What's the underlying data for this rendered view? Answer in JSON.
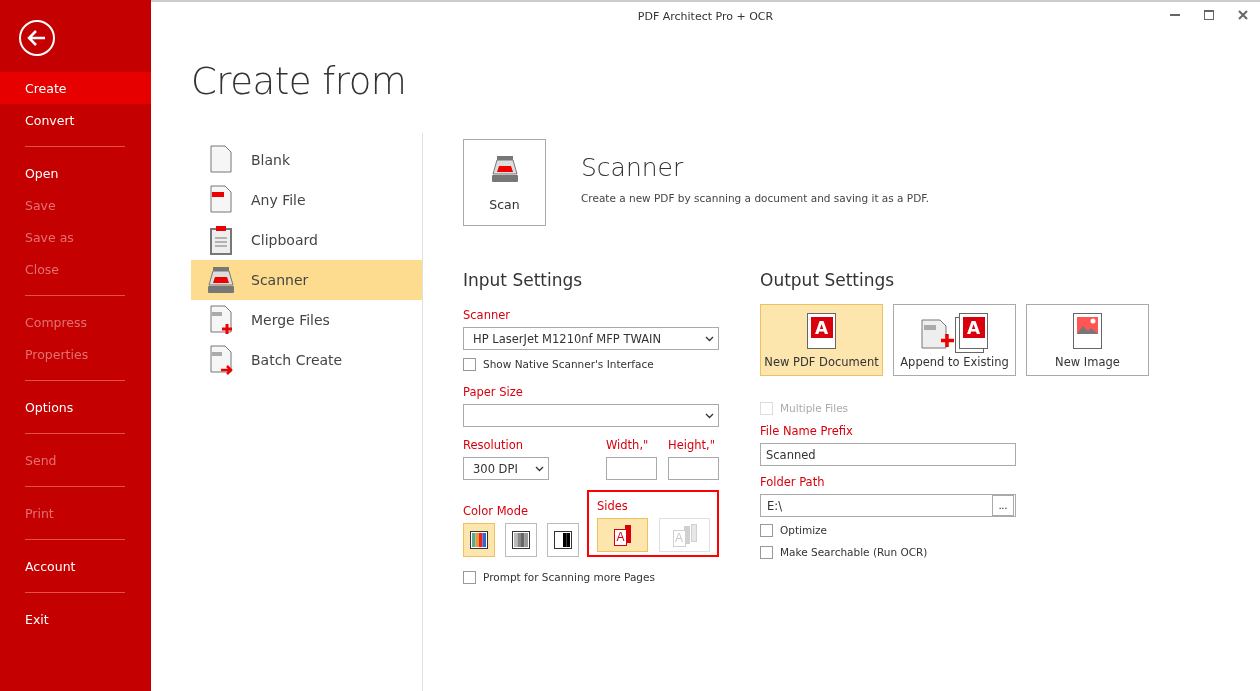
{
  "window": {
    "title": "PDF Architect Pro + OCR"
  },
  "sidebar": {
    "groups": [
      {
        "items": [
          {
            "label": "Create",
            "selected": true,
            "disabled": false
          },
          {
            "label": "Convert",
            "selected": false,
            "disabled": false
          }
        ]
      },
      {
        "items": [
          {
            "label": "Open",
            "selected": false,
            "disabled": false
          },
          {
            "label": "Save",
            "selected": false,
            "disabled": true
          },
          {
            "label": "Save as",
            "selected": false,
            "disabled": true
          },
          {
            "label": "Close",
            "selected": false,
            "disabled": true
          }
        ]
      },
      {
        "items": [
          {
            "label": "Compress",
            "selected": false,
            "disabled": true
          },
          {
            "label": "Properties",
            "selected": false,
            "disabled": true
          }
        ]
      },
      {
        "items": [
          {
            "label": "Options",
            "selected": false,
            "disabled": false
          }
        ]
      },
      {
        "items": [
          {
            "label": "Send",
            "selected": false,
            "disabled": true
          }
        ]
      },
      {
        "items": [
          {
            "label": "Print",
            "selected": false,
            "disabled": true
          }
        ]
      },
      {
        "items": [
          {
            "label": "Account",
            "selected": false,
            "disabled": false
          }
        ]
      },
      {
        "items": [
          {
            "label": "Exit",
            "selected": false,
            "disabled": false
          }
        ]
      }
    ]
  },
  "page_title": "Create from",
  "sources": [
    {
      "label": "Blank",
      "kind": "blank",
      "selected": false
    },
    {
      "label": "Any File",
      "kind": "file",
      "selected": false
    },
    {
      "label": "Clipboard",
      "kind": "clipboard",
      "selected": false
    },
    {
      "label": "Scanner",
      "kind": "scanner",
      "selected": true
    },
    {
      "label": "Merge Files",
      "kind": "merge",
      "selected": false
    },
    {
      "label": "Batch Create",
      "kind": "batch",
      "selected": false
    }
  ],
  "scanner": {
    "button": "Scan",
    "title": "Scanner",
    "description": "Create a new PDF by scanning a document and saving it as a PDF."
  },
  "input_settings": {
    "heading": "Input Settings",
    "scanner_label": "Scanner",
    "scanner_value": "HP LaserJet M1210nf MFP TWAIN",
    "show_native": {
      "label": "Show Native Scanner's Interface",
      "checked": false
    },
    "paper_size_label": "Paper Size",
    "resolution_label": "Resolution",
    "resolution_value": "300 DPI",
    "width_label": "Width,\"",
    "height_label": "Height,\"",
    "color_mode_label": "Color Mode",
    "color_modes": [
      {
        "kind": "color",
        "selected": true
      },
      {
        "kind": "gray",
        "selected": false
      },
      {
        "kind": "bw",
        "selected": false
      }
    ],
    "sides_label": "Sides",
    "sides_highlighted": true,
    "sides": [
      {
        "kind": "single",
        "glyph": "A",
        "selected": true,
        "disabled": false
      },
      {
        "kind": "duplex",
        "glyph": "A",
        "selected": false,
        "disabled": true
      }
    ],
    "prompt": {
      "label": "Prompt for Scanning more Pages",
      "checked": false
    }
  },
  "output_settings": {
    "heading": "Output Settings",
    "options": [
      {
        "label": "New PDF Document",
        "kind": "pdf",
        "glyph": "A",
        "selected": true
      },
      {
        "label": "Append to Existing",
        "kind": "append",
        "glyph": "A",
        "selected": false
      },
      {
        "label": "New Image",
        "kind": "image",
        "selected": false
      }
    ],
    "multiple_files": {
      "label": "Multiple Files",
      "checked": false,
      "disabled": true
    },
    "prefix_label": "File Name Prefix",
    "prefix_value": "Scanned",
    "folder_label": "Folder Path",
    "folder_value": "E:\\",
    "browse": "...",
    "optimize": {
      "label": "Optimize",
      "checked": false
    },
    "searchable": {
      "label": "Make Searchable (Run OCR)",
      "checked": false
    }
  }
}
